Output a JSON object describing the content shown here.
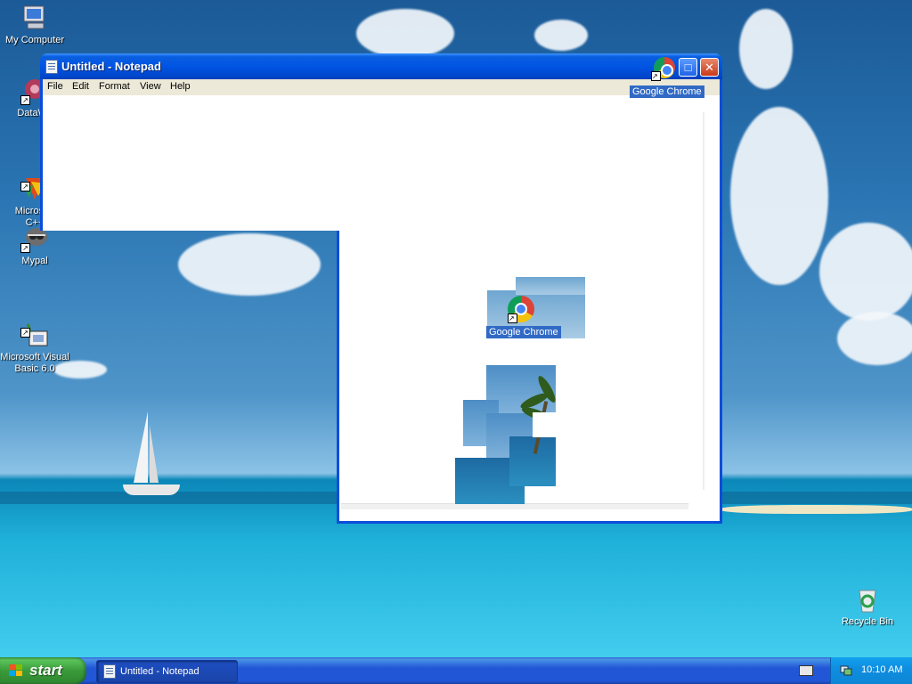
{
  "desktop": {
    "icons": [
      {
        "label": "My Computer"
      },
      {
        "label": "DataWa"
      },
      {
        "label": "Microsoft\nC++"
      },
      {
        "label": "Mypal"
      },
      {
        "label": "Microsoft Visual\nBasic 6.0"
      },
      {
        "label": "Recycle Bin"
      }
    ],
    "floating_icons": [
      {
        "label": "Google Chrome"
      },
      {
        "label": "Google Chrome"
      }
    ]
  },
  "notepad": {
    "title": "Untitled - Notepad",
    "menu": [
      "File",
      "Edit",
      "Format",
      "View",
      "Help"
    ],
    "buttons": {
      "minimize": "_",
      "maximize": "□",
      "close": "✕"
    }
  },
  "taskbar": {
    "start_label": "start",
    "tasks": [
      {
        "label": "Untitled - Notepad"
      }
    ],
    "clock": "10:10 AM"
  },
  "colors": {
    "titlebar": "#0054e3",
    "taskbar": "#2157d7",
    "start": "#3a9b3a",
    "selection": "#316ac5"
  },
  "icons": [
    "computer-icon",
    "datawa-icon",
    "cpp-icon",
    "mypal-icon",
    "vb6-icon",
    "recycle-bin-icon",
    "chrome-icon",
    "notepad-icon",
    "windows-flag-icon",
    "keyboard-icon",
    "network-icon"
  ]
}
